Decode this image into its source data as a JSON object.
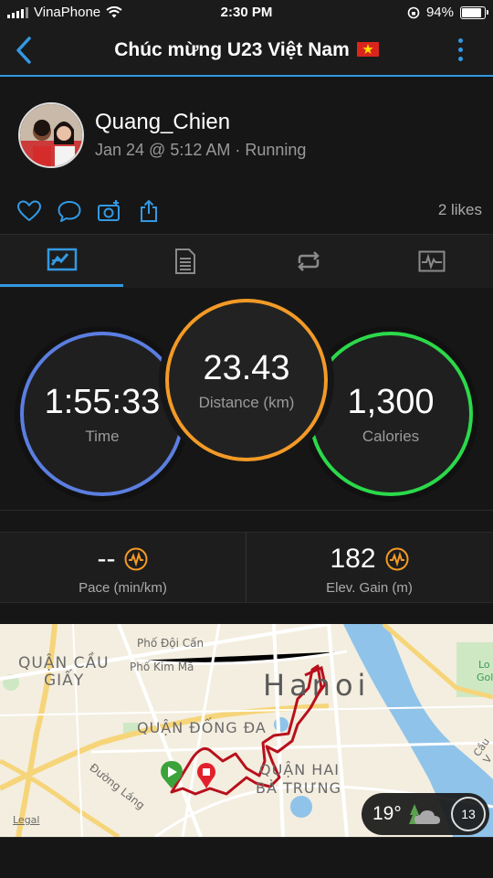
{
  "status_bar": {
    "carrier": "VinaPhone",
    "time": "2:30 PM",
    "battery": "94%",
    "battery_level": 0.94
  },
  "header": {
    "title": "Chúc mừng U23 Việt Nam",
    "back_icon": "chevron-left-icon",
    "menu_icon": "more-vertical-icon",
    "accent": "#3399e3"
  },
  "activity": {
    "user": "Quang_Chien",
    "meta": "Jan 24 @ 5:12 AM · Running",
    "likes": "2 likes"
  },
  "actions": [
    "like-icon",
    "comment-icon",
    "add-photo-icon",
    "share-icon"
  ],
  "tabs": [
    {
      "name": "stats",
      "icon": "stats-icon",
      "active": true
    },
    {
      "name": "details",
      "icon": "document-icon",
      "active": false
    },
    {
      "name": "laps",
      "icon": "laps-icon",
      "active": false
    },
    {
      "name": "charts",
      "icon": "chart-icon",
      "active": false
    }
  ],
  "summary": {
    "time": {
      "value": "1:55:33",
      "label": "Time",
      "color": "#5b7ee0"
    },
    "distance": {
      "value": "23.43",
      "label": "Distance (km)",
      "color": "#f39a26"
    },
    "calories": {
      "value": "1,300",
      "label": "Calories",
      "color": "#2bd94a"
    }
  },
  "metrics": [
    {
      "value": "--",
      "label": "Pace (min/km)"
    },
    {
      "value": "182",
      "label": "Elev. Gain (m)"
    }
  ],
  "map": {
    "labels": {
      "cau_giay_1": "QUẬN CẦU",
      "cau_giay_2": "GIẤY",
      "doi_can": "Phố Đội Cấn",
      "kim_ma": "Phố Kim Mã",
      "hanoi": "Hanoi",
      "dong_da": "QUẬN ĐỐNG ĐA",
      "hai_ba_1": "QUẬN HAI",
      "hai_ba_2": "BÀ TRƯNG",
      "duong_lang": "Đường Láng",
      "legal": "Legal",
      "right_1": "Lo",
      "right_2": "Gol",
      "right_3": "Cầu V"
    },
    "weather": {
      "temp": "19°",
      "hour": "13"
    },
    "route_color": "#b8101c"
  }
}
